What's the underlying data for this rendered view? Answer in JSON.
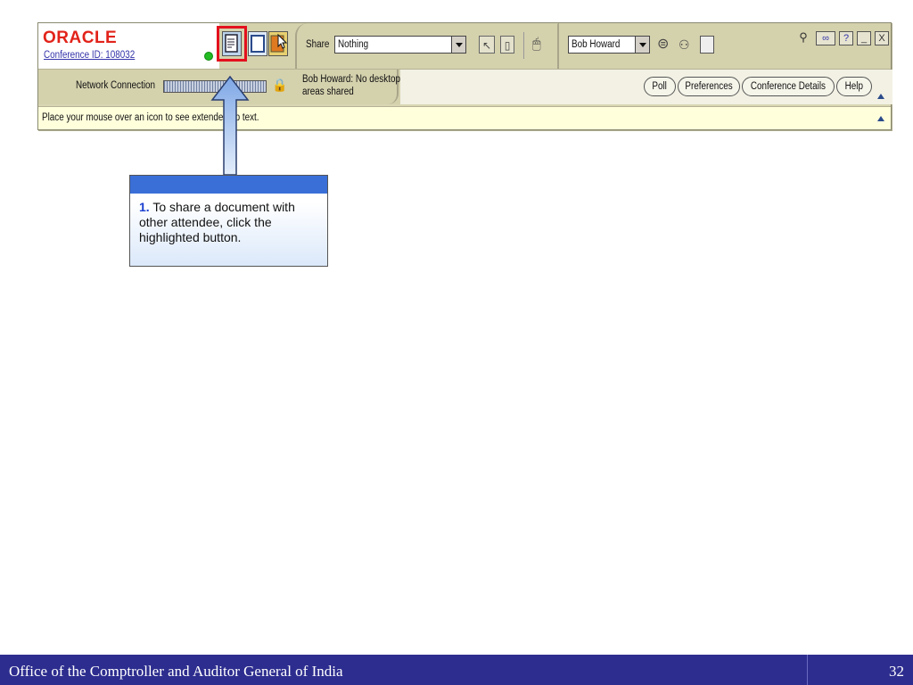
{
  "brand": {
    "logo_text": "ORACLE",
    "conference_id": "Conference ID: 108032"
  },
  "share": {
    "label": "Share",
    "selected": "Nothing"
  },
  "user": {
    "selected": "Bob Howard"
  },
  "network": {
    "label": "Network Connection"
  },
  "status": {
    "share_status": "Bob Howard: No desktop areas shared"
  },
  "buttons": {
    "poll": "Poll",
    "preferences": "Preferences",
    "conference_details": "Conference Details",
    "help": "Help"
  },
  "window_controls": {
    "help": "?",
    "minimize": "_",
    "close": "X"
  },
  "tip": {
    "text": "Place your mouse over an icon to see extended tip text."
  },
  "callout": {
    "step": "1.",
    "text": "To share a document with other attendee, click the highlighted button."
  },
  "footer": {
    "organization": "Office of the Comptroller and Auditor General of India",
    "page_number": "32"
  },
  "colors": {
    "highlight": "#e3101d",
    "footer_bg": "#2d2d8f",
    "oracle_red": "#e2231a",
    "callout_header": "#3a6fd8"
  },
  "icons": [
    "document-share-icon",
    "whiteboard-icon",
    "application-share-icon",
    "pointer-icon",
    "mouse-icon",
    "chat-icon",
    "attendees-icon",
    "save-icon",
    "zoom-icon",
    "video-icon",
    "lock-icon",
    "collapse-arrow-icon"
  ]
}
